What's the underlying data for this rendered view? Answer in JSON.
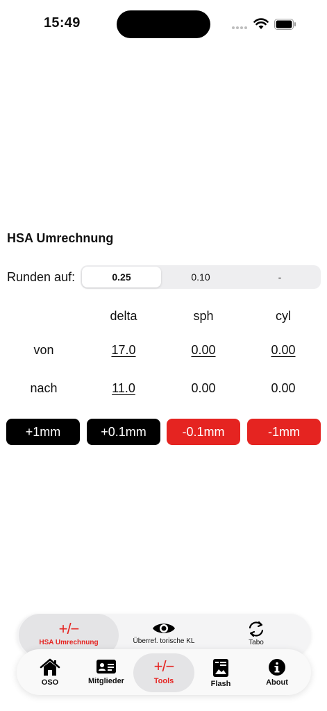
{
  "status": {
    "time": "15:49"
  },
  "title": "HSA Umrechnung",
  "rounding": {
    "label": "Runden auf:",
    "options": [
      "0.25",
      "0.10",
      "-"
    ],
    "selected": "0.25"
  },
  "table": {
    "headers": [
      "delta",
      "sph",
      "cyl"
    ],
    "rows": [
      {
        "label": "von",
        "delta": "17.0",
        "sph": "0.00",
        "cyl": "0.00"
      },
      {
        "label": "nach",
        "delta": "11.0",
        "sph": "0.00",
        "cyl": "0.00"
      }
    ]
  },
  "buttons": {
    "plus1": "+1mm",
    "plus01": "+0.1mm",
    "minus01": "-0.1mm",
    "minus1": "-1mm"
  },
  "sub_tabs": [
    {
      "label": "HSA Umrechnung",
      "icon": "plus-minus-icon",
      "active": true
    },
    {
      "label": "Überref. torische KL",
      "icon": "eye-icon",
      "active": false
    },
    {
      "label": "Tabo",
      "icon": "rotate-icon",
      "active": false
    }
  ],
  "tabs": [
    {
      "label": "OSO",
      "icon": "house-icon",
      "active": false
    },
    {
      "label": "Mitglieder",
      "icon": "id-card-icon",
      "active": false
    },
    {
      "label": "Tools",
      "icon": "plus-minus-icon",
      "active": true
    },
    {
      "label": "Flash",
      "icon": "flashcard-icon",
      "active": false
    },
    {
      "label": "About",
      "icon": "info-icon",
      "active": false
    }
  ],
  "icon_glyphs": {
    "plus_minus": "+/−"
  },
  "colors": {
    "accent": "#e52421",
    "primary": "#000000"
  }
}
